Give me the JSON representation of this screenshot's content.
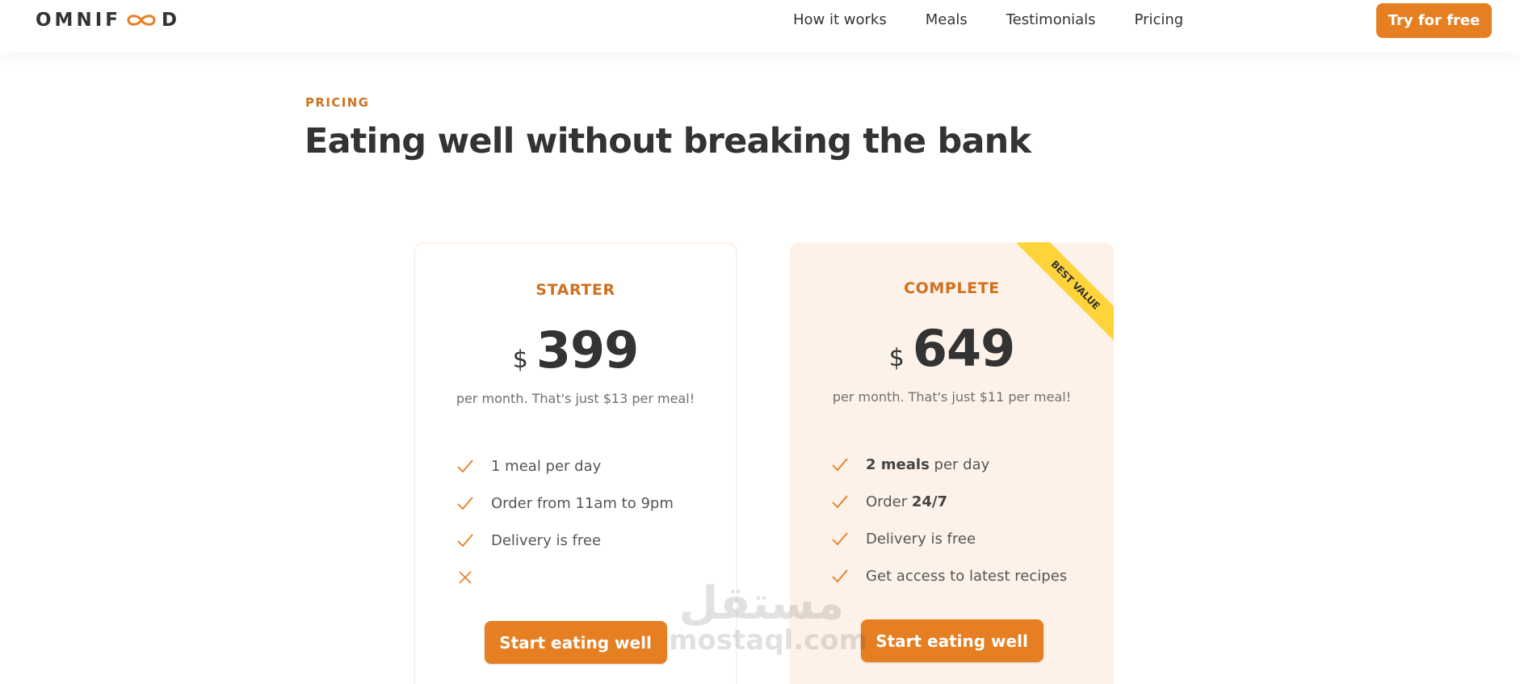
{
  "brand": {
    "logo_text_left": "OMNIF",
    "logo_text_right": "D"
  },
  "nav": {
    "items": [
      "How it works",
      "Meals",
      "Testimonials",
      "Pricing"
    ],
    "cta": "Try for free"
  },
  "section": {
    "subheading": "PRICING",
    "heading": "Eating well without breaking the bank"
  },
  "plans": [
    {
      "name": "STARTER",
      "currency": "$",
      "price": "399",
      "note": "per month. That's just $13 per meal!",
      "features": [
        {
          "icon": "check-icon",
          "text": "1 meal per day"
        },
        {
          "icon": "check-icon",
          "text": "Order from 11am to 9pm"
        },
        {
          "icon": "check-icon",
          "text": "Delivery is free"
        },
        {
          "icon": "close-icon",
          "text": ""
        }
      ],
      "button": "Start eating well"
    },
    {
      "name": "COMPLETE",
      "currency": "$",
      "price": "649",
      "note": "per month. That's just $11 per meal!",
      "ribbon": "BEST VALUE",
      "features": [
        {
          "icon": "check-icon",
          "bold": "2 meals",
          "text": " per day"
        },
        {
          "icon": "check-icon",
          "text": "Order ",
          "bold_after": "24/7"
        },
        {
          "icon": "check-icon",
          "text": "Delivery is free"
        },
        {
          "icon": "check-icon",
          "text": "Get access to latest recipes"
        }
      ],
      "button": "Start eating well"
    }
  ],
  "watermark": {
    "arabic": "مستقل",
    "latin": "mostaql.com"
  },
  "colors": {
    "accent": "#e67e22",
    "accent_dark": "#cf711f",
    "card_tint": "#fdf2e9",
    "ribbon": "#ffd43b",
    "text": "#333333"
  }
}
